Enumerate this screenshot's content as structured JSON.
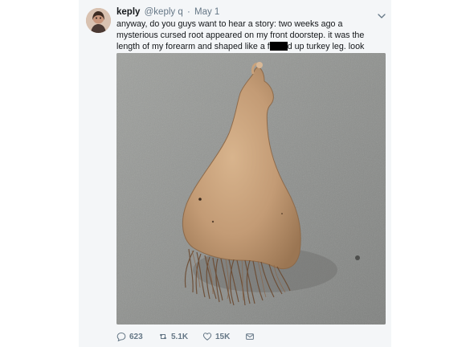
{
  "tweet": {
    "author_name": "keply",
    "author_handle": "@keply q",
    "separator": "·",
    "date": "May 1",
    "text_part1": "anyway, do you guys want to hear a story: two weeks ago a mysterious cursed root appeared on my front doorstep. it was the length of my forearm and shaped like a f",
    "text_part2": "d up turkey leg. look here it is",
    "image_alt": "cursed root"
  },
  "actions": {
    "reply_count": "623",
    "retweet_count": "5.1K",
    "like_count": "15K"
  },
  "icons": {
    "avatar": "avatar",
    "menu": "chevron-down-icon",
    "reply": "reply-icon",
    "retweet": "retweet-icon",
    "like": "heart-icon",
    "dm": "envelope-icon"
  },
  "colors": {
    "text": "#14171a",
    "muted": "#657786",
    "card": "#f4f6f8"
  }
}
